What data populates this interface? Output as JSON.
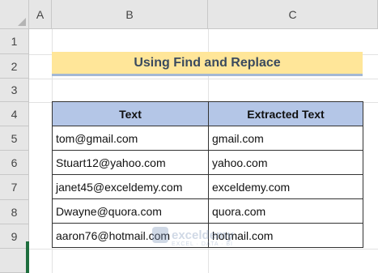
{
  "columns": [
    "A",
    "B",
    "C"
  ],
  "rows": [
    "1",
    "2",
    "3",
    "4",
    "5",
    "6",
    "7",
    "8",
    "9"
  ],
  "title": "Using Find and Replace",
  "table": {
    "headers": [
      "Text",
      "Extracted Text"
    ],
    "rows": [
      [
        "tom@gmail.com",
        "gmail.com"
      ],
      [
        "Stuart12@yahoo.com",
        "yahoo.com"
      ],
      [
        "janet45@exceldemy.com",
        "exceldemy.com"
      ],
      [
        "Dwayne@quora.com",
        "quora.com"
      ],
      [
        "aaron76@hotmail.com",
        "hotmail.com"
      ]
    ]
  },
  "watermark": {
    "name": "exceldemy",
    "tagline": "EXCEL · DATA · BI"
  }
}
